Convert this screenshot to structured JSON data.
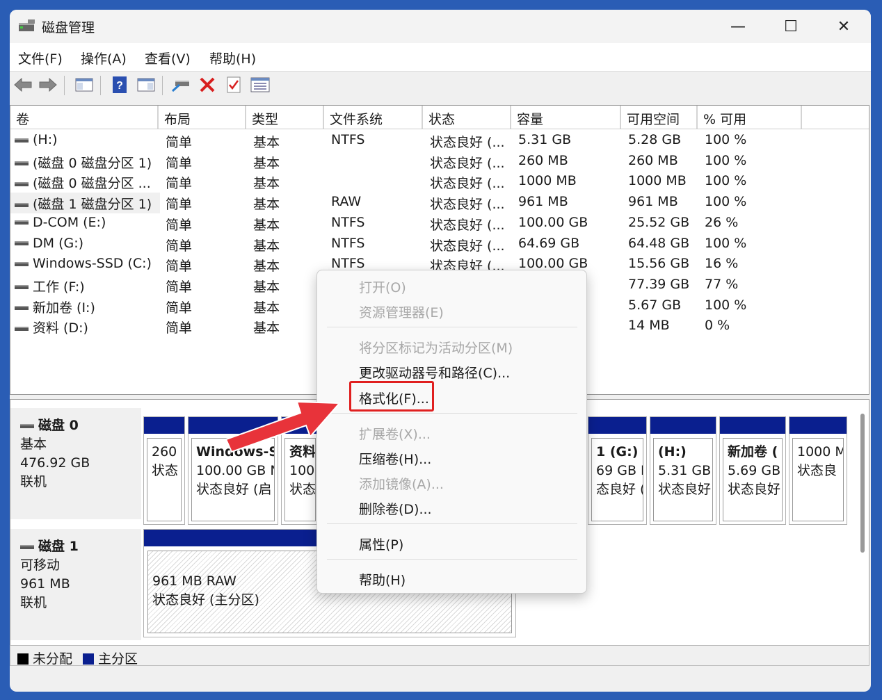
{
  "window": {
    "title": "磁盘管理",
    "minimize": "—",
    "maximize": "☐",
    "close": "✕"
  },
  "menubar": {
    "file": "文件(F)",
    "action": "操作(A)",
    "view": "查看(V)",
    "help": "帮助(H)"
  },
  "columns": [
    "卷",
    "布局",
    "类型",
    "文件系统",
    "状态",
    "容量",
    "可用空间",
    "% 可用"
  ],
  "volumes": [
    {
      "name": "(H:)",
      "layout": "简单",
      "type": "基本",
      "fs": "NTFS",
      "status": "状态良好 (...",
      "capacity": "5.31 GB",
      "free": "5.28 GB",
      "pct": "100 %"
    },
    {
      "name": "(磁盘 0 磁盘分区 1)",
      "layout": "简单",
      "type": "基本",
      "fs": "",
      "status": "状态良好 (...",
      "capacity": "260 MB",
      "free": "260 MB",
      "pct": "100 %"
    },
    {
      "name": "(磁盘 0 磁盘分区 ...",
      "layout": "简单",
      "type": "基本",
      "fs": "",
      "status": "状态良好 (...",
      "capacity": "1000 MB",
      "free": "1000 MB",
      "pct": "100 %"
    },
    {
      "name": "(磁盘 1 磁盘分区 1)",
      "layout": "简单",
      "type": "基本",
      "fs": "RAW",
      "status": "状态良好 (...",
      "capacity": "961 MB",
      "free": "961 MB",
      "pct": "100 %"
    },
    {
      "name": "D-COM (E:)",
      "layout": "简单",
      "type": "基本",
      "fs": "NTFS",
      "status": "状态良好 (...",
      "capacity": "100.00 GB",
      "free": "25.52 GB",
      "pct": "26 %"
    },
    {
      "name": "DM (G:)",
      "layout": "简单",
      "type": "基本",
      "fs": "NTFS",
      "status": "状态良好 (...",
      "capacity": "64.69 GB",
      "free": "64.48 GB",
      "pct": "100 %"
    },
    {
      "name": "Windows-SSD (C:)",
      "layout": "简单",
      "type": "基本",
      "fs": "NTFS",
      "status": "状态良好 (...",
      "capacity": "100.00 GB",
      "free": "15.56 GB",
      "pct": "16 %"
    },
    {
      "name": "工作 (F:)",
      "layout": "简单",
      "type": "基本",
      "fs": "",
      "status": "",
      "capacity": "",
      "free": "77.39 GB",
      "pct": "77 %"
    },
    {
      "name": "新加卷 (I:)",
      "layout": "简单",
      "type": "基本",
      "fs": "",
      "status": "",
      "capacity": "",
      "free": "5.67 GB",
      "pct": "100 %"
    },
    {
      "name": "资料 (D:)",
      "layout": "简单",
      "type": "基本",
      "fs": "",
      "status": "",
      "capacity": "",
      "free": "14 MB",
      "pct": "0 %"
    }
  ],
  "disk0": {
    "name": "磁盘 0",
    "kind": "基本",
    "size": "476.92 GB",
    "state": "联机",
    "parts": [
      {
        "l1": "",
        "l2": "260",
        "l3": "状态"
      },
      {
        "l1": "Windows-S",
        "l2": "100.00 GB N",
        "l3": "状态良好 (启"
      },
      {
        "l1": "资料",
        "l2": "100.",
        "l3": "状态"
      },
      {
        "l1": "1 (G:)",
        "l2": "69 GB N",
        "l3": "态良好 (主"
      },
      {
        "l1": "(H:)",
        "l2": "5.31 GB",
        "l3": "状态良好"
      },
      {
        "l1": "新加卷 (",
        "l2": "5.69 GB",
        "l3": "状态良好"
      },
      {
        "l1": "",
        "l2": "1000 M",
        "l3": "状态良"
      }
    ]
  },
  "disk1": {
    "name": "磁盘 1",
    "kind": "可移动",
    "size": "961 MB",
    "state": "联机",
    "part": {
      "l1": "961 MB RAW",
      "l2": "状态良好 (主分区)"
    }
  },
  "legend": {
    "unalloc": "未分配",
    "primary": "主分区",
    "unalloc_color": "#000000",
    "primary_color": "#0a1f8f"
  },
  "context_menu": {
    "open": "打开(O)",
    "explorer": "资源管理器(E)",
    "mark_active": "将分区标记为活动分区(M)",
    "change_letter": "更改驱动器号和路径(C)...",
    "format": "格式化(F)...",
    "extend": "扩展卷(X)...",
    "shrink": "压缩卷(H)...",
    "mirror": "添加镜像(A)...",
    "delete": "删除卷(D)...",
    "properties": "属性(P)",
    "help": "帮助(H)"
  }
}
